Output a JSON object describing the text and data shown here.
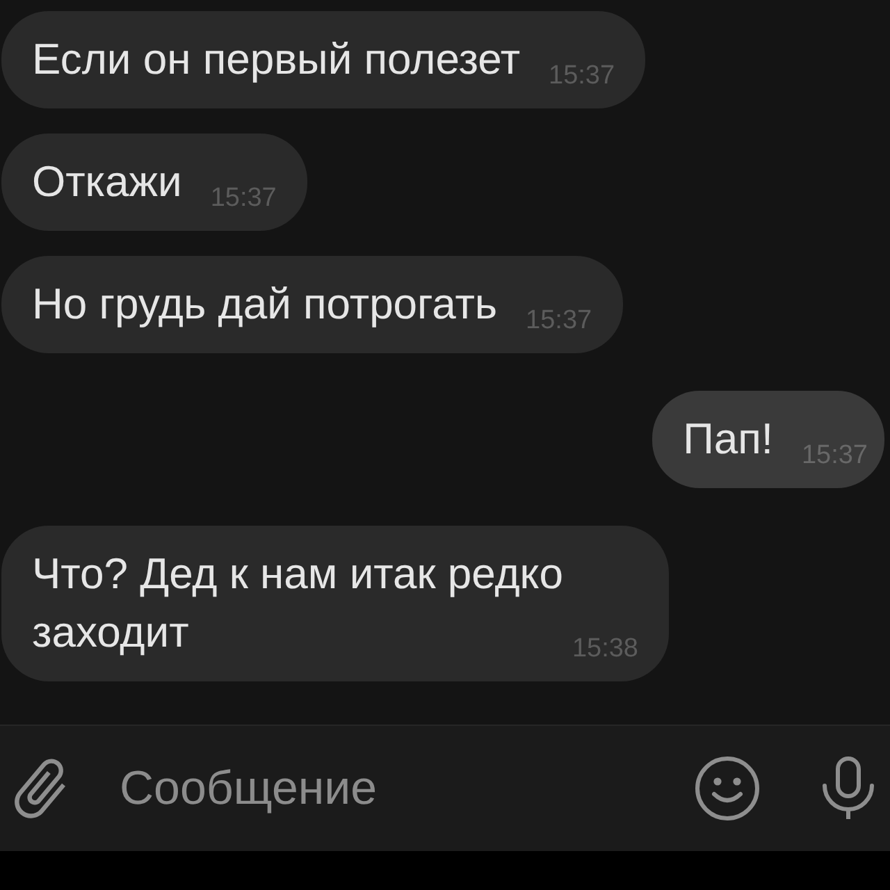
{
  "messages": [
    {
      "kind": "incoming",
      "text": "Если он первый полезет",
      "time": "15:37"
    },
    {
      "kind": "incoming",
      "text": "Откажи",
      "time": "15:37"
    },
    {
      "kind": "incoming",
      "text": "Но грудь дай потрогать",
      "time": "15:37"
    },
    {
      "kind": "outgoing",
      "text": "Пап!",
      "time": "15:37"
    },
    {
      "kind": "incoming",
      "text": "Что? Дед к нам итак редко заходит",
      "time": "15:38"
    }
  ],
  "composer": {
    "placeholder": "Сообщение"
  }
}
